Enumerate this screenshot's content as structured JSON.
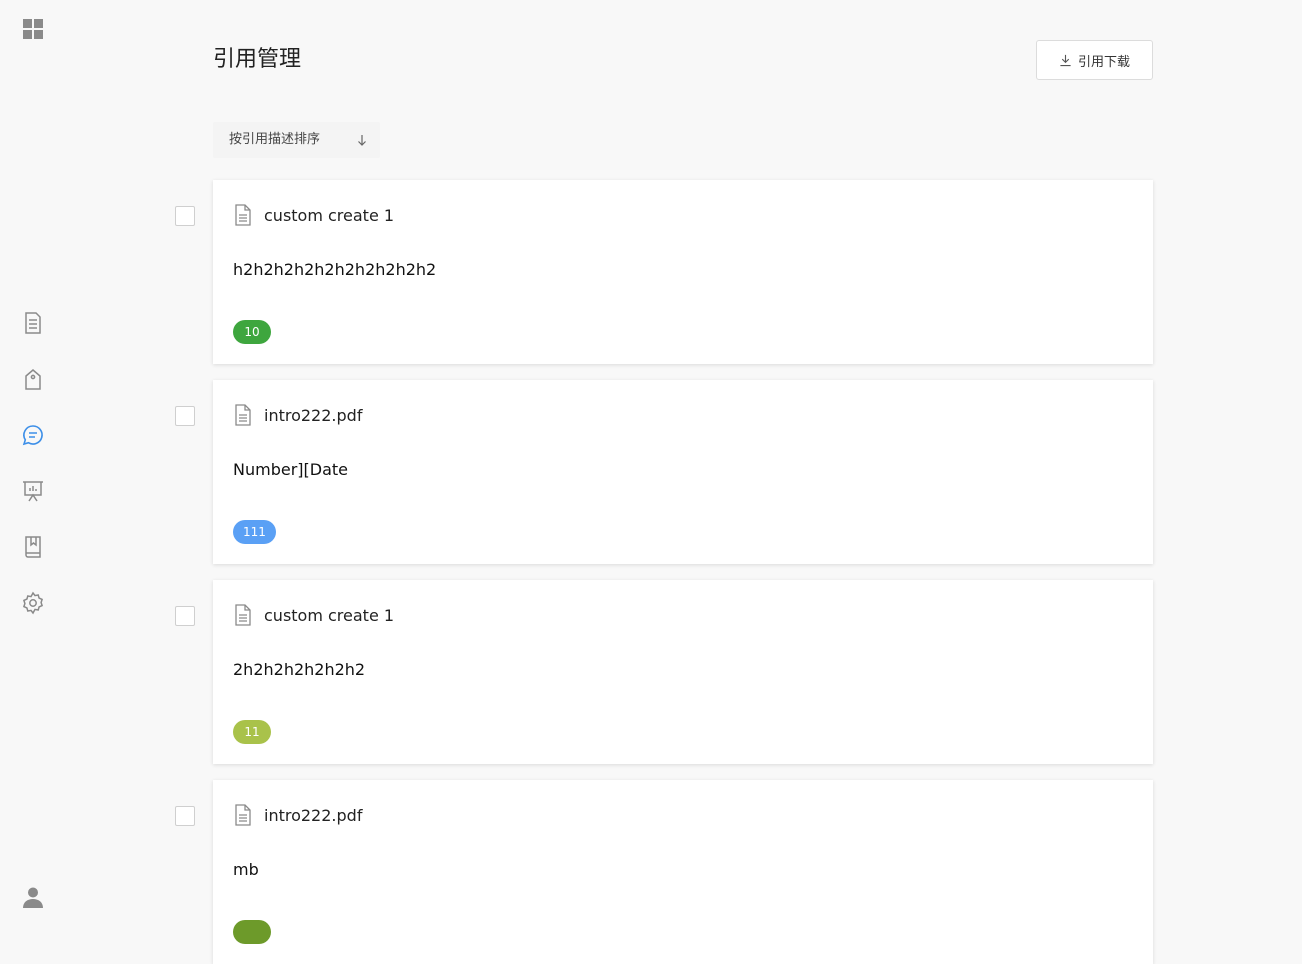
{
  "header": {
    "title": "引用管理",
    "download_label": "引用下载"
  },
  "sort": {
    "label": "按引用描述排序",
    "direction_icon": "arrow-down-icon"
  },
  "sidebar": {
    "items": [
      {
        "name": "apps",
        "icon": "grid-icon",
        "active": false
      },
      {
        "name": "documents",
        "icon": "document-icon",
        "active": false
      },
      {
        "name": "tags",
        "icon": "tag-icon",
        "active": false
      },
      {
        "name": "citations",
        "icon": "chat-icon",
        "active": true
      },
      {
        "name": "presentations",
        "icon": "presentation-icon",
        "active": false
      },
      {
        "name": "library",
        "icon": "book-icon",
        "active": false
      },
      {
        "name": "settings",
        "icon": "gear-icon",
        "active": false
      },
      {
        "name": "user",
        "icon": "user-icon",
        "active": false
      }
    ]
  },
  "colors": {
    "active_icon": "#3d8fe8",
    "inactive_icon": "#8a8a8a",
    "badge_green": "#3ea63e",
    "badge_blue": "#5aa0f5",
    "badge_lime": "#a9c24a",
    "badge_olive": "#6d9a2a"
  },
  "citations": [
    {
      "source": "custom create 1",
      "text": "h2h2h2h2h2h2h2h2h2h2",
      "badge": "10",
      "badge_color": "#3ea63e"
    },
    {
      "source": "intro222.pdf",
      "text": "Number][Date",
      "badge": "111",
      "badge_color": "#5aa0f5"
    },
    {
      "source": "custom create 1",
      "text": "2h2h2h2h2h2h2",
      "badge": "11",
      "badge_color": "#a9c24a"
    },
    {
      "source": "intro222.pdf",
      "text": "mb",
      "badge": "",
      "badge_color": "#6d9a2a"
    }
  ]
}
